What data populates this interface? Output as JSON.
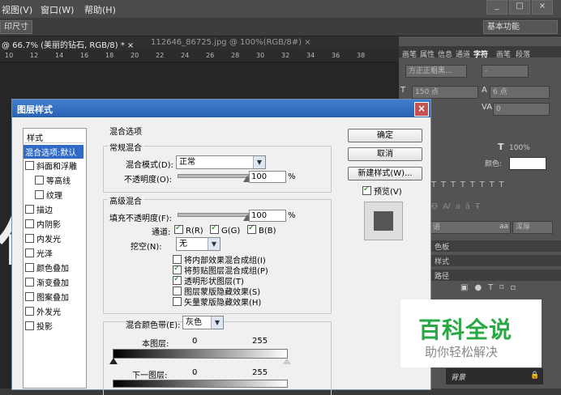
{
  "menubar": {
    "items": [
      "视图(V)",
      "窗口(W)",
      "帮助(H)"
    ],
    "win_buttons": [
      "_",
      "□",
      "×"
    ]
  },
  "optionsbar": {
    "print_size": "印尺寸",
    "workspace": "基本功能"
  },
  "tabs": [
    "@ 66.7% (美丽的钻石, RGB/8) * ×",
    "112646_86725.jpg @ 100%(RGB/8#) ×"
  ],
  "ruler": [
    "10",
    "12",
    "14",
    "16",
    "18",
    "20",
    "22",
    "24",
    "26",
    "28",
    "30",
    "32",
    "34",
    "36",
    "38"
  ],
  "right_panel": {
    "tabs": [
      "画笔",
      "属性",
      "信息",
      "通道",
      "字符",
      "画笔",
      "段落"
    ],
    "font_family": "方正正粗黑...",
    "font_style": "-",
    "font_size": "150 点",
    "leading": "6 点",
    "kerning": "0",
    "scale": "100%",
    "color_label": "颜色:",
    "lang": "语",
    "aa_label": "aa",
    "aa_value": "浑厚",
    "panel_rows": [
      "色板",
      "样式",
      "路径"
    ],
    "layer_name": "背景"
  },
  "canvas_text": "句",
  "dialog": {
    "title": "图层样式",
    "close": "×",
    "styles_header": "样式",
    "styles": [
      {
        "label": "混合选项:默认",
        "checkbox": false,
        "selected": true
      },
      {
        "label": "斜面和浮雕",
        "checkbox": true,
        "checked": false
      },
      {
        "label": "等高线",
        "checkbox": true,
        "checked": false,
        "indent": true
      },
      {
        "label": "纹理",
        "checkbox": true,
        "checked": false,
        "indent": true
      },
      {
        "label": "描边",
        "checkbox": true,
        "checked": false
      },
      {
        "label": "内阴影",
        "checkbox": true,
        "checked": false
      },
      {
        "label": "内发光",
        "checkbox": true,
        "checked": false
      },
      {
        "label": "光泽",
        "checkbox": true,
        "checked": false
      },
      {
        "label": "颜色叠加",
        "checkbox": true,
        "checked": false
      },
      {
        "label": "渐变叠加",
        "checkbox": true,
        "checked": false
      },
      {
        "label": "图案叠加",
        "checkbox": true,
        "checked": false
      },
      {
        "label": "外发光",
        "checkbox": true,
        "checked": false
      },
      {
        "label": "投影",
        "checkbox": true,
        "checked": false
      }
    ],
    "blend_options": "混合选项",
    "general_blending": "常规混合",
    "blend_mode_label": "混合模式(D):",
    "blend_mode_value": "正常",
    "opacity_label": "不透明度(O):",
    "opacity_value": "100",
    "opacity_unit": "%",
    "opacity_level": 1.0,
    "advanced_blending": "高级混合",
    "fill_opacity_label": "填充不透明度(F):",
    "fill_opacity_value": "100",
    "fill_opacity_unit": "%",
    "fill_opacity_level": 1.0,
    "channels_label": "通道:",
    "channels": [
      {
        "label": "R(R)",
        "checked": true
      },
      {
        "label": "G(G)",
        "checked": true
      },
      {
        "label": "B(B)",
        "checked": true
      }
    ],
    "knockout_label": "挖空(N):",
    "knockout_value": "无",
    "options": [
      {
        "label": "将内部效果混合成组(I)",
        "checked": false
      },
      {
        "label": "将剪贴图层混合成组(P)",
        "checked": true
      },
      {
        "label": "透明形状图层(T)",
        "checked": true
      },
      {
        "label": "图层蒙版隐藏效果(S)",
        "checked": false
      },
      {
        "label": "矢量蒙版隐藏效果(H)",
        "checked": false
      }
    ],
    "blend_if_label": "混合颜色带(E):",
    "blend_if_value": "灰色",
    "this_layer_label": "本图层:",
    "this_layer_min": "0",
    "this_layer_max": "255",
    "underlying_label": "下一图层:",
    "underlying_min": "0",
    "underlying_max": "255",
    "ok_button": "确定",
    "cancel_button": "取消",
    "new_style_button": "新建样式(W)...",
    "preview_label": "预览(V)",
    "preview_checked": true
  },
  "watermark": {
    "title": "百科全说",
    "subtitle": "助你轻松解决"
  },
  "colors": {
    "dialog_title": "#2b62b3",
    "selected_item": "#316ac5",
    "watermark_green": "#2aa845"
  }
}
